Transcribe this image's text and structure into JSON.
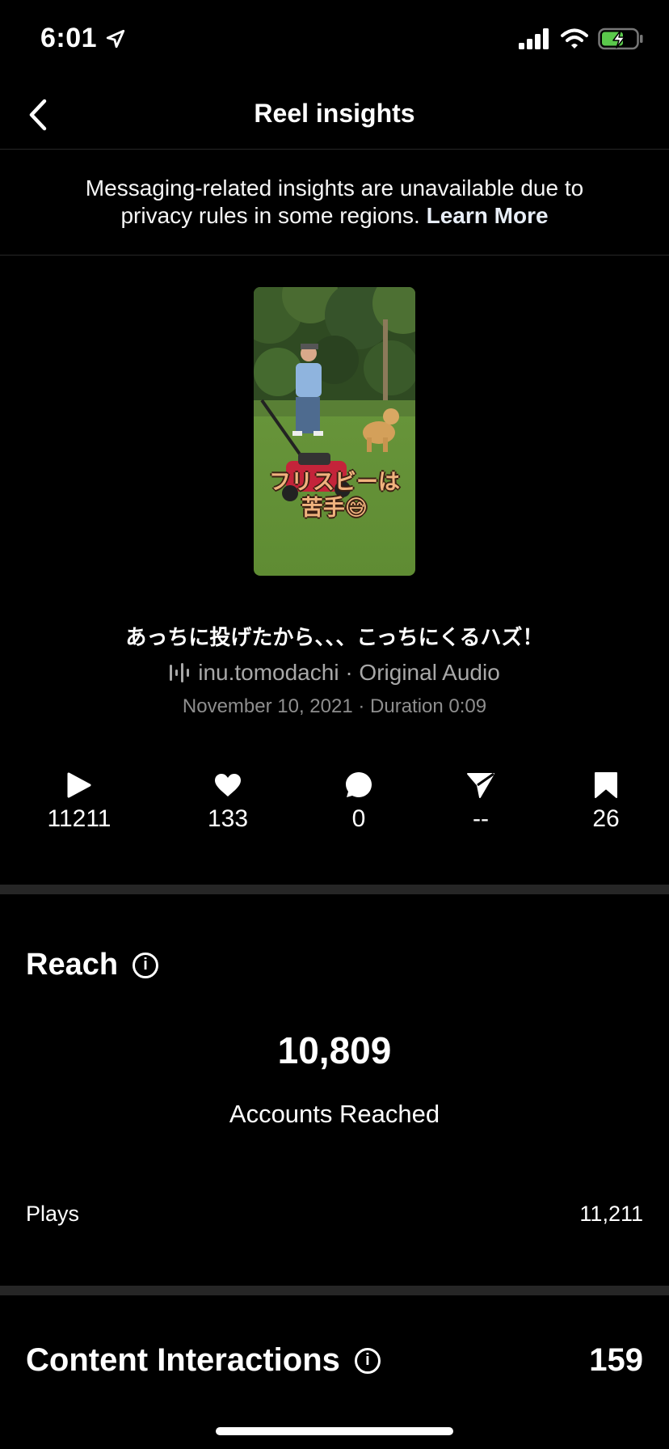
{
  "status_bar": {
    "time": "6:01"
  },
  "nav": {
    "title": "Reel insights"
  },
  "notice": {
    "text": "Messaging-related insights are unavailable due to privacy rules in some regions.",
    "link": "Learn More"
  },
  "reel": {
    "thumbnail_caption_line1": "フリスビーは",
    "thumbnail_caption_line2": "苦手😅",
    "title": "あっちに投げたから、、、こっちにくるハズ！",
    "audio": "inu.tomodachi · Original Audio",
    "meta": "November 10, 2021 · Duration 0:09"
  },
  "stats": {
    "plays": "11211",
    "likes": "133",
    "comments": "0",
    "shares": "--",
    "saves": "26"
  },
  "reach": {
    "title": "Reach",
    "accounts_reached_value": "10,809",
    "accounts_reached_label": "Accounts Reached",
    "plays_label": "Plays",
    "plays_value": "11,211"
  },
  "content_interactions": {
    "title": "Content Interactions",
    "value": "159"
  },
  "icons": [
    "location-arrow-icon",
    "signal-icon",
    "wifi-icon",
    "battery-charging-icon",
    "back-chevron-icon",
    "audio-wave-icon",
    "play-icon",
    "heart-icon",
    "comment-icon",
    "share-icon",
    "bookmark-icon",
    "info-icon"
  ]
}
